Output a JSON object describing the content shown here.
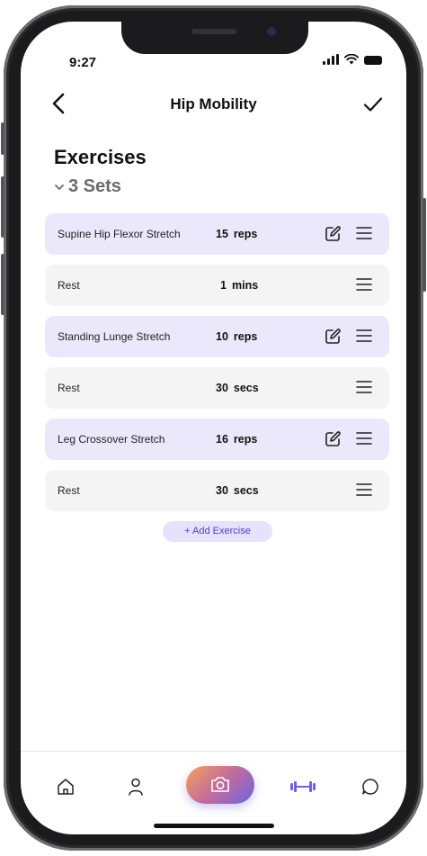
{
  "status": {
    "time": "9:27"
  },
  "header": {
    "title": "Hip Mobility"
  },
  "section": {
    "title": "Exercises",
    "sets_label": "3 Sets"
  },
  "rows": [
    {
      "kind": "exercise",
      "name": "Supine Hip Flexor Stretch",
      "amount": "15",
      "unit": "reps"
    },
    {
      "kind": "rest",
      "name": "Rest",
      "amount": "1",
      "unit": "mins"
    },
    {
      "kind": "exercise",
      "name": "Standing Lunge Stretch",
      "amount": "10",
      "unit": "reps"
    },
    {
      "kind": "rest",
      "name": "Rest",
      "amount": "30",
      "unit": "secs"
    },
    {
      "kind": "exercise",
      "name": "Leg Crossover Stretch",
      "amount": "16",
      "unit": "reps"
    },
    {
      "kind": "rest",
      "name": "Rest",
      "amount": "30",
      "unit": "secs"
    }
  ],
  "add_exercise_label": "+ Add Exercise",
  "icons": {
    "back": "chevron-left-icon",
    "done": "checkmark-icon",
    "edit": "edit-icon",
    "drag": "drag-handle-icon",
    "tabs": [
      "home-icon",
      "profile-icon",
      "camera-icon",
      "dumbbell-icon",
      "chat-icon"
    ]
  },
  "colors": {
    "exercise_row": "#ebe8fb",
    "rest_row": "#f4f4f5",
    "accent": "#6f62e0",
    "active_tab": "#6f62e0"
  }
}
